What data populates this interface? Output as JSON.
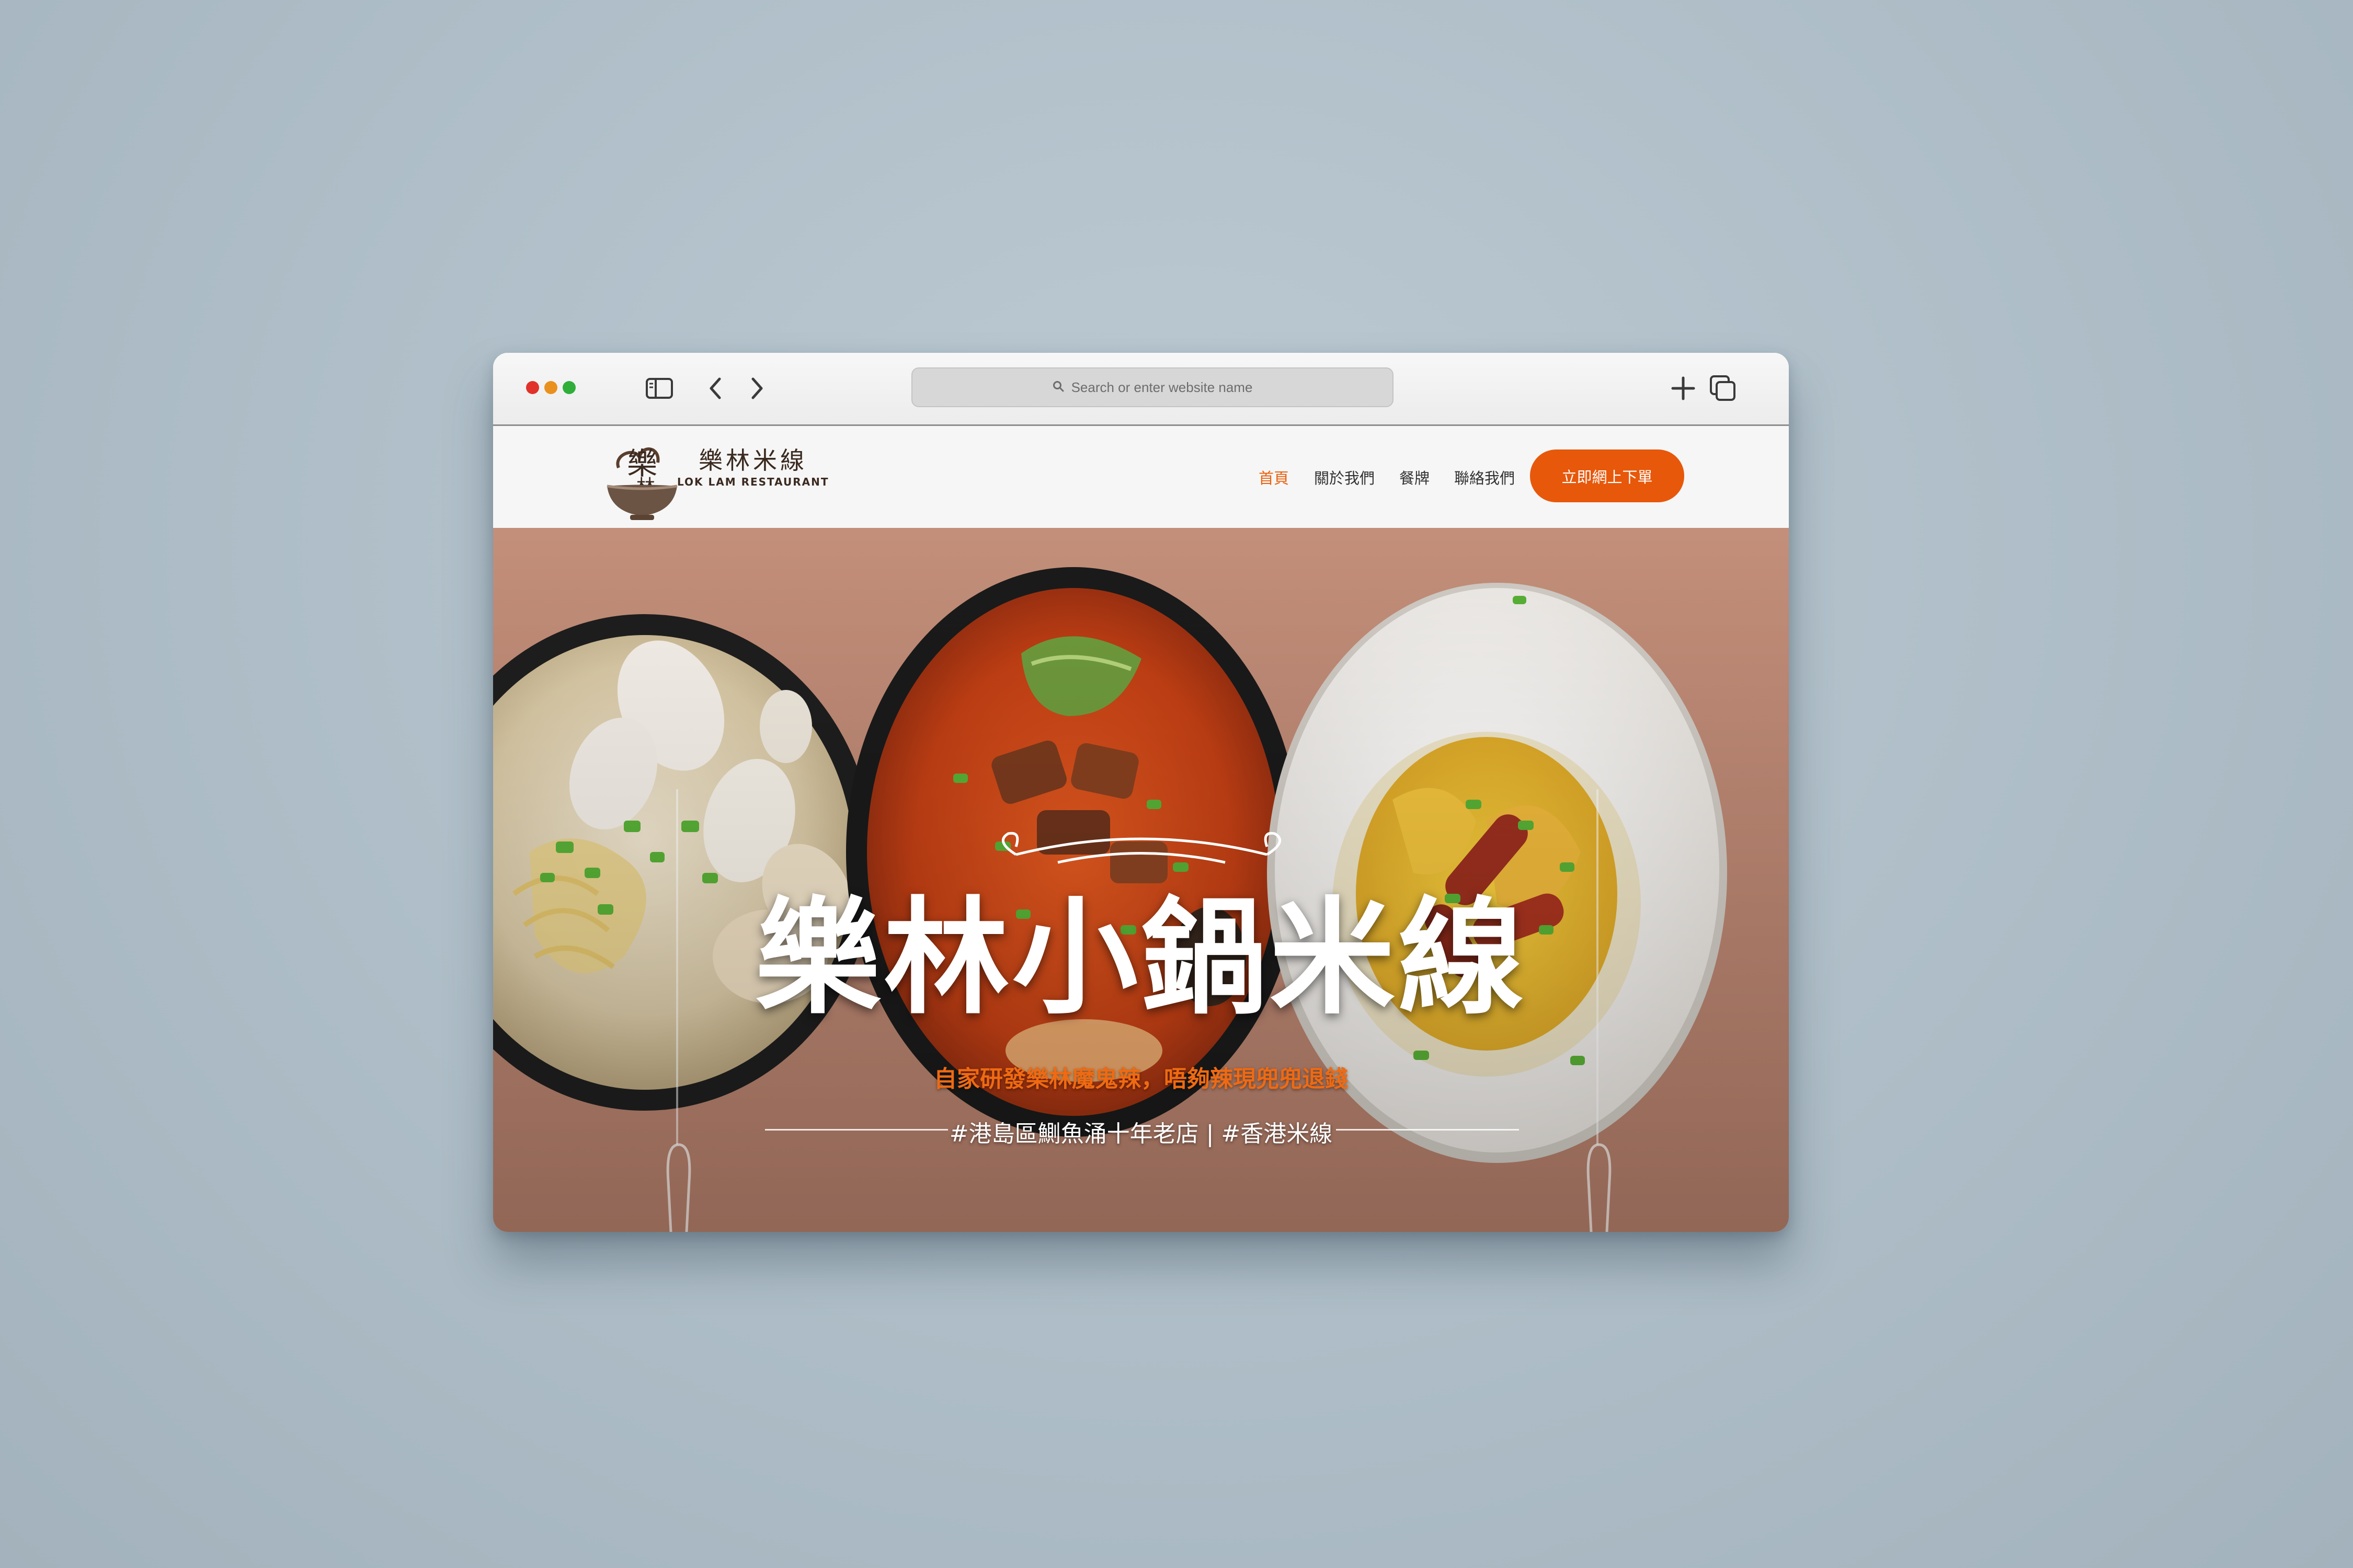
{
  "browser": {
    "address_placeholder": "Search or enter website name",
    "icons": [
      "sidebar-icon",
      "back-icon",
      "forward-icon",
      "search-icon",
      "new-tab-icon",
      "tabs-icon"
    ],
    "traffic_lights": {
      "close": "#e0322a",
      "minimize": "#e9901f",
      "zoom": "#2fae3a"
    }
  },
  "site": {
    "brand_cn": "樂林米線",
    "brand_en": "LOK LAM RESTAURANT",
    "nav": [
      {
        "label": "首頁",
        "active": true
      },
      {
        "label": "關於我們",
        "active": false
      },
      {
        "label": "餐牌",
        "active": false
      },
      {
        "label": "聯絡我們",
        "active": false
      }
    ],
    "cta_label": "立即網上下單",
    "accent_color": "#e7580b"
  },
  "hero": {
    "title": "樂林小鍋米線",
    "subtitle": "自家研發樂林魔鬼辣，唔夠辣現兜兜退錢",
    "tags": "#港島區鰂魚涌十年老店 | #香港米線",
    "background_color": "#bb8672"
  }
}
